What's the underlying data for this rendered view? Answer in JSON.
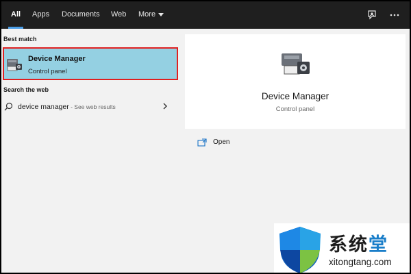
{
  "tabs": [
    {
      "label": "All",
      "active": true
    },
    {
      "label": "Apps"
    },
    {
      "label": "Documents"
    },
    {
      "label": "Web"
    },
    {
      "label": "More"
    }
  ],
  "top_icons": [
    "feedback-icon",
    "ellipsis-icon"
  ],
  "left": {
    "best_match_label": "Best match",
    "best_match": {
      "title": "Device Manager",
      "subtitle": "Control panel",
      "icon": "device-manager-icon"
    },
    "search_web_label": "Search the web",
    "web_result": {
      "query": "device manager",
      "hint": " - See web results",
      "icon": "search-icon"
    }
  },
  "right": {
    "title": "Device Manager",
    "subtitle": "Control panel",
    "actions": [
      {
        "label": "Open",
        "icon": "open-icon"
      }
    ]
  },
  "watermark": {
    "chinese_text": "系统",
    "chinese_accent": "堂",
    "url": "xitongtang.com"
  },
  "colors": {
    "topbar": "#1f1f1f",
    "selected_result": "#94d0e2",
    "highlight_border": "#e02020",
    "accent": "#4a9ee8"
  }
}
